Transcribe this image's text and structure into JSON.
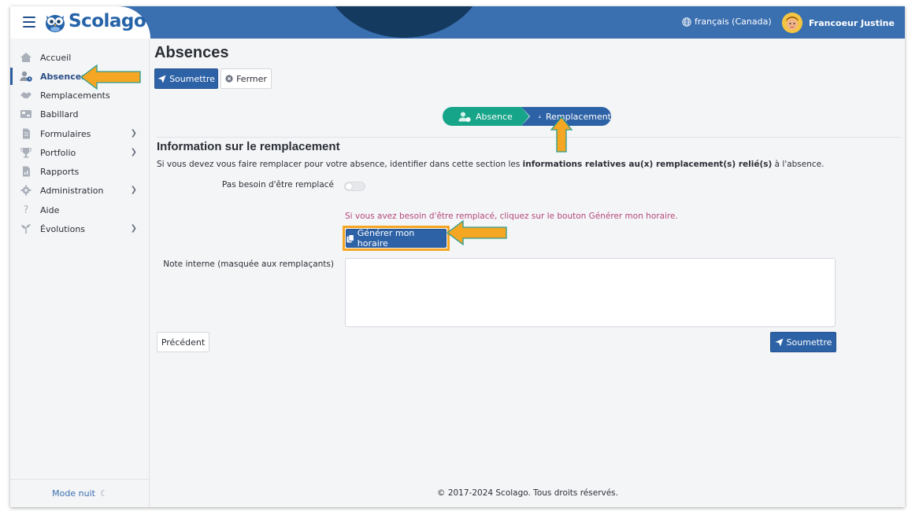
{
  "header": {
    "brand": "Scolago",
    "language": "français (Canada)",
    "user_name": "Francoeur Justine"
  },
  "sidebar": {
    "items": [
      {
        "label": "Accueil",
        "icon": "home-icon"
      },
      {
        "label": "Absences",
        "icon": "user-clock-icon",
        "active": true
      },
      {
        "label": "Remplacements",
        "icon": "handshake-icon"
      },
      {
        "label": "Babillard",
        "icon": "board-icon"
      },
      {
        "label": "Formulaires",
        "icon": "document-icon",
        "has_children": true
      },
      {
        "label": "Portfolio",
        "icon": "trophy-icon",
        "has_children": true
      },
      {
        "label": "Rapports",
        "icon": "report-icon"
      },
      {
        "label": "Administration",
        "icon": "gear-icon",
        "has_children": true
      },
      {
        "label": "Aide",
        "icon": "question-icon"
      },
      {
        "label": "Évolutions",
        "icon": "sprout-icon",
        "has_children": true
      }
    ],
    "mode_nuit": "Mode nuit"
  },
  "page": {
    "title": "Absences",
    "submit_label": "Soumettre",
    "close_label": "Fermer",
    "steps": [
      {
        "label": "Absence",
        "color": "#17a589"
      },
      {
        "label": "Remplacement",
        "color": "#2d62a6"
      }
    ],
    "section_title": "Information sur le remplacement",
    "section_desc_before": "Si vous devez vous faire remplacer pour votre absence, identifier dans cette section les ",
    "section_desc_bold": "informations relatives au(x) remplacement(s) relié(s)",
    "section_desc_after": " à l'absence.",
    "no_replacement_label": "Pas besoin d'être remplacé",
    "hint": "Si vous avez besoin d'être remplacé, cliquez sur le bouton Générer mon horaire.",
    "generate_label": "Générer mon horaire",
    "note_label": "Note interne (masquée aux remplaçants)",
    "previous_label": "Précédent",
    "submit_bottom_label": "Soumettre",
    "footer": "© 2017-2024 Scolago. Tous droits réservés."
  },
  "colors": {
    "primary": "#2d62a6",
    "topbar": "#3a6fb0",
    "step_done": "#17a589",
    "hint": "#b4497c",
    "annotation_arrow": "#f5a623"
  }
}
